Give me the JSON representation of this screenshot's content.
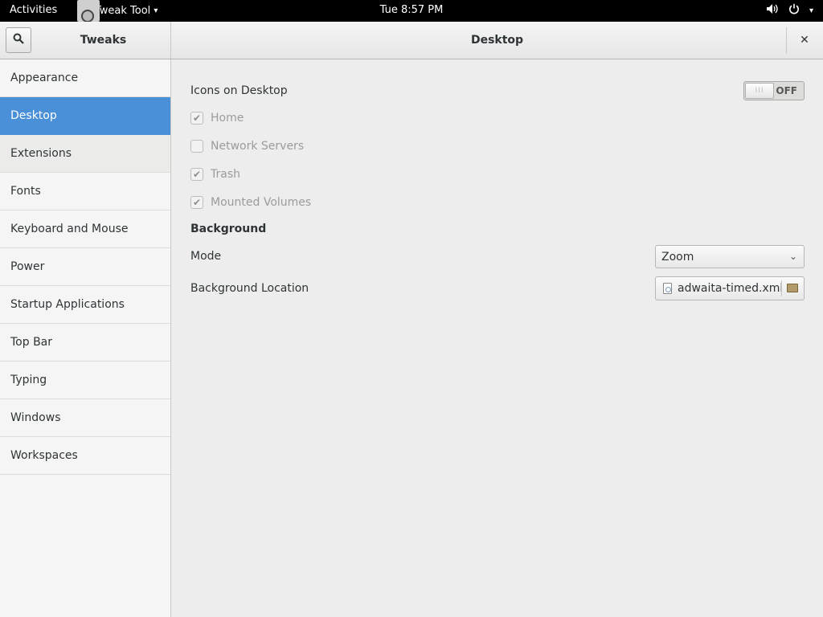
{
  "topbar": {
    "activities": "Activities",
    "app_menu": "Tweak Tool",
    "app_menu_arrow": "▾",
    "clock": "Tue  8:57 PM",
    "volume_icon": "speaker-icon",
    "power_icon": "power-icon",
    "status_arrow": "▾"
  },
  "header": {
    "sidebar_title": "Tweaks",
    "title": "Desktop",
    "close_glyph": "✕"
  },
  "sidebar": {
    "items": [
      {
        "label": "Appearance"
      },
      {
        "label": "Desktop"
      },
      {
        "label": "Extensions"
      },
      {
        "label": "Fonts"
      },
      {
        "label": "Keyboard and Mouse"
      },
      {
        "label": "Power"
      },
      {
        "label": "Startup Applications"
      },
      {
        "label": "Top Bar"
      },
      {
        "label": "Typing"
      },
      {
        "label": "Windows"
      },
      {
        "label": "Workspaces"
      }
    ],
    "selected": "Desktop"
  },
  "main": {
    "icons_on_desktop": {
      "label": "Icons on Desktop",
      "state": "OFF",
      "knob_glyph": "III"
    },
    "checkboxes": [
      {
        "label": "Home",
        "checked": true
      },
      {
        "label": "Network Servers",
        "checked": false
      },
      {
        "label": "Trash",
        "checked": true
      },
      {
        "label": "Mounted Volumes",
        "checked": true
      }
    ],
    "check_glyph": "✔",
    "background_heading": "Background",
    "mode": {
      "label": "Mode",
      "value": "Zoom",
      "chevron": "⌄"
    },
    "background_location": {
      "label": "Background Location",
      "value": "adwaita-timed.xml"
    }
  },
  "colors": {
    "accent": "#4a90d9",
    "topbar": "#000000",
    "window_bg": "#ededed"
  }
}
